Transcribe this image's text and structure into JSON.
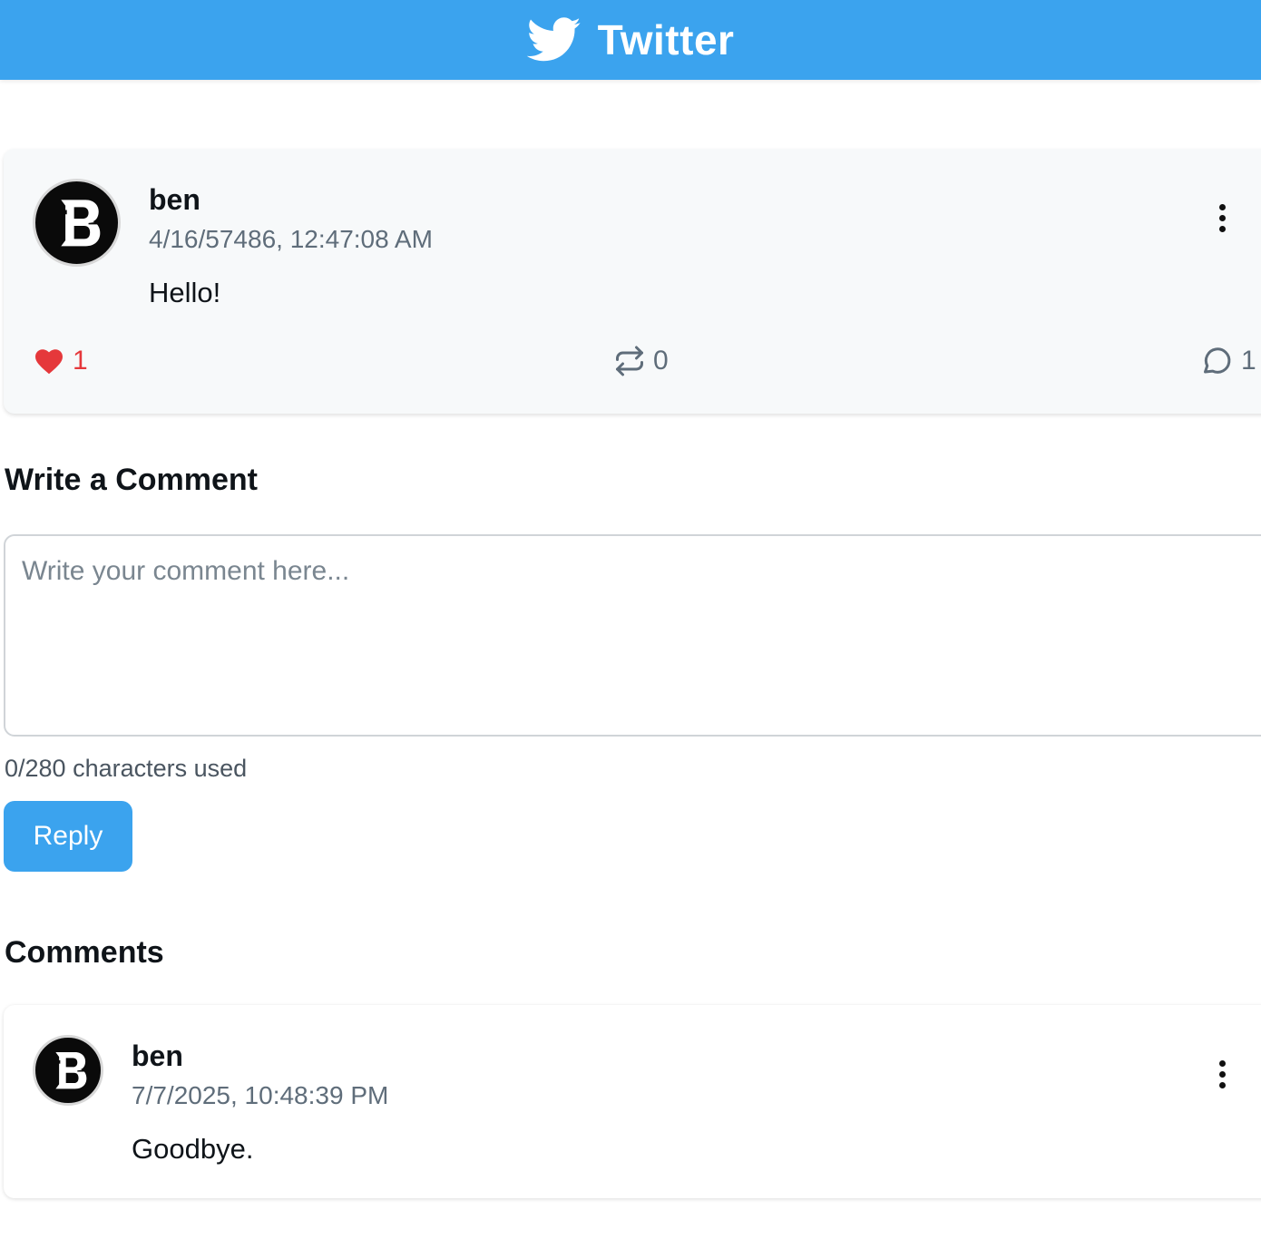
{
  "header": {
    "brand": "Twitter",
    "icon": "twitter-bird-icon"
  },
  "tweet": {
    "author": "ben",
    "timestamp": "4/16/57486, 12:47:08 AM",
    "text": "Hello!",
    "likes": "1",
    "retweets": "0",
    "replies": "1"
  },
  "compose": {
    "title": "Write a Comment",
    "placeholder": "Write your comment here...",
    "char_count": "0/280 characters used",
    "submit_label": "Reply"
  },
  "comments": {
    "title": "Comments",
    "items": [
      {
        "author": "ben",
        "timestamp": "7/7/2025, 10:48:39 PM",
        "text": "Goodbye."
      }
    ]
  },
  "colors": {
    "brand": "#3ba3ee",
    "like": "#e5383b",
    "muted": "#5f6d7a"
  }
}
